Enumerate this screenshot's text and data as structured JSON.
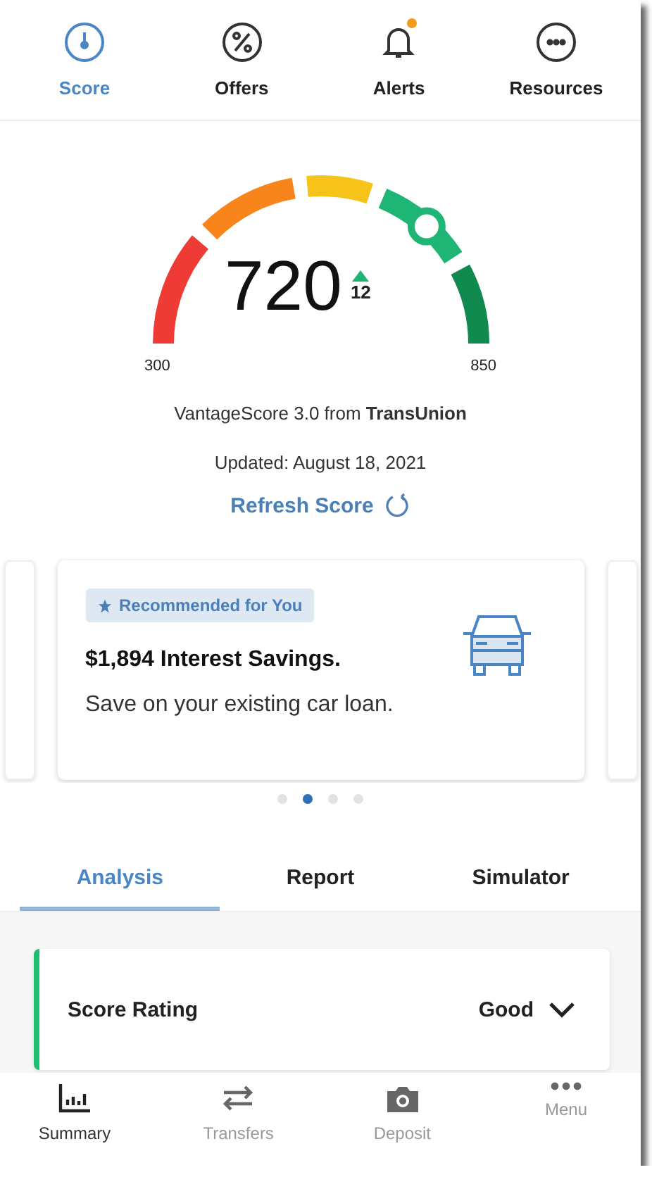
{
  "top_nav": [
    {
      "label": "Score",
      "selected": true,
      "badge": false
    },
    {
      "label": "Offers",
      "selected": false,
      "badge": false
    },
    {
      "label": "Alerts",
      "selected": false,
      "badge": true
    },
    {
      "label": "Resources",
      "selected": false,
      "badge": false
    }
  ],
  "score": {
    "value": "720",
    "change": "12",
    "min": "300",
    "max": "850",
    "source": "VantageScore 3.0 from **TransUnion**",
    "updated": "Updated: August 18, 2021",
    "refresh": "Refresh Score"
  },
  "offer_card": {
    "tag": "Recommended for You",
    "title": "$1,894 Interest Savings.",
    "text": "Save on your existing car loan."
  },
  "carousel_dots": [
    {
      "selected": false
    },
    {
      "selected": true
    },
    {
      "selected": false
    },
    {
      "selected": false
    }
  ],
  "tabs": [
    {
      "label": "Analysis",
      "selected": true
    },
    {
      "label": "Report",
      "selected": false
    },
    {
      "label": "Simulator",
      "selected": false
    }
  ],
  "rating": {
    "label": "Score Rating",
    "value": "Good",
    "color": "#1fbf6f"
  },
  "bottom_nav": [
    {
      "label": "Summary",
      "selected": true
    },
    {
      "label": "Transfers",
      "selected": false
    },
    {
      "label": "Deposit",
      "selected": false
    },
    {
      "label": "Menu",
      "selected": false
    }
  ]
}
